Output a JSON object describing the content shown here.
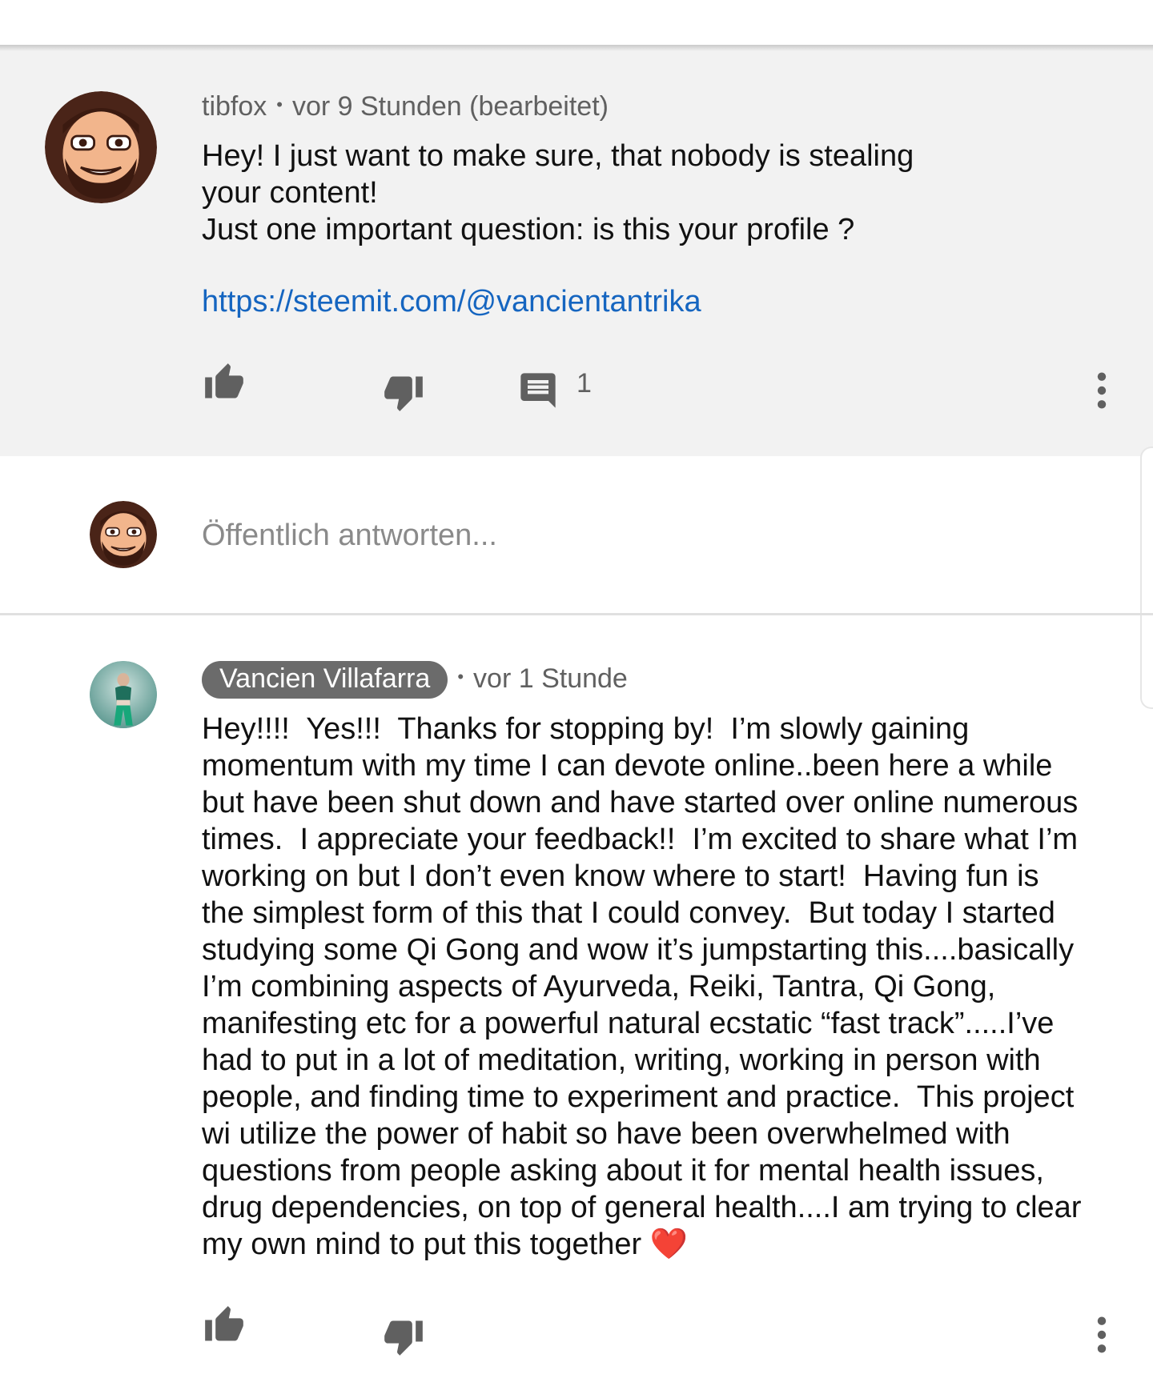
{
  "comment1": {
    "author": "tibfox",
    "separator": "•",
    "time": "vor 9 Stunden (bearbeitet)",
    "text": "Hey! I just want to make sure, that nobody is stealing\nyour content!\nJust one important question: is this your profile ?",
    "link": "https://steemit.com/@vancientantrika",
    "reply_count": "1",
    "icons": {
      "like": "thumbs-up-icon",
      "dislike": "thumbs-down-icon",
      "reply": "comment-icon",
      "more": "more-vert-icon"
    }
  },
  "reply_box": {
    "placeholder": "Öffentlich antworten..."
  },
  "comment2": {
    "author": "Vancien Villafarra",
    "separator": "•",
    "time": "vor 1 Stunde",
    "text": "Hey!!!!  Yes!!!  Thanks for stopping by!  I’m slowly gaining\nmomentum with my time I can devote online..been here a while\nbut have been shut down and have started over online numerous\ntimes.  I appreciate your feedback!!  I’m excited to share what I’m\nworking on but I don’t even know where to start!  Having fun is\nthe simplest form of this that I could convey.  But today I started\nstudying some Qi Gong and wow it’s jumpstarting this....basically\nI’m combining aspects of Ayurveda, Reiki, Tantra, Qi Gong,\nmanifesting etc for a powerful natural ecstatic “fast track”.....I’ve\nhad to put in a lot of meditation, writing, working in person with\npeople, and finding time to experiment and practice.  This project\nwi utilize the power of habit so have been overwhelmed with\nquestions from people asking about it for mental health issues,\ndrug dependencies, on top of general health....I am trying to clear\nmy own mind to put this together",
    "emoji": "❤️",
    "icons": {
      "like": "thumbs-up-icon",
      "dislike": "thumbs-down-icon",
      "more": "more-vert-icon"
    }
  },
  "colors": {
    "highlight_bg": "#f2f2f2",
    "link": "#1565c0",
    "meta": "#606060",
    "icon": "#606060",
    "author_chip": "#6b6b6b"
  }
}
